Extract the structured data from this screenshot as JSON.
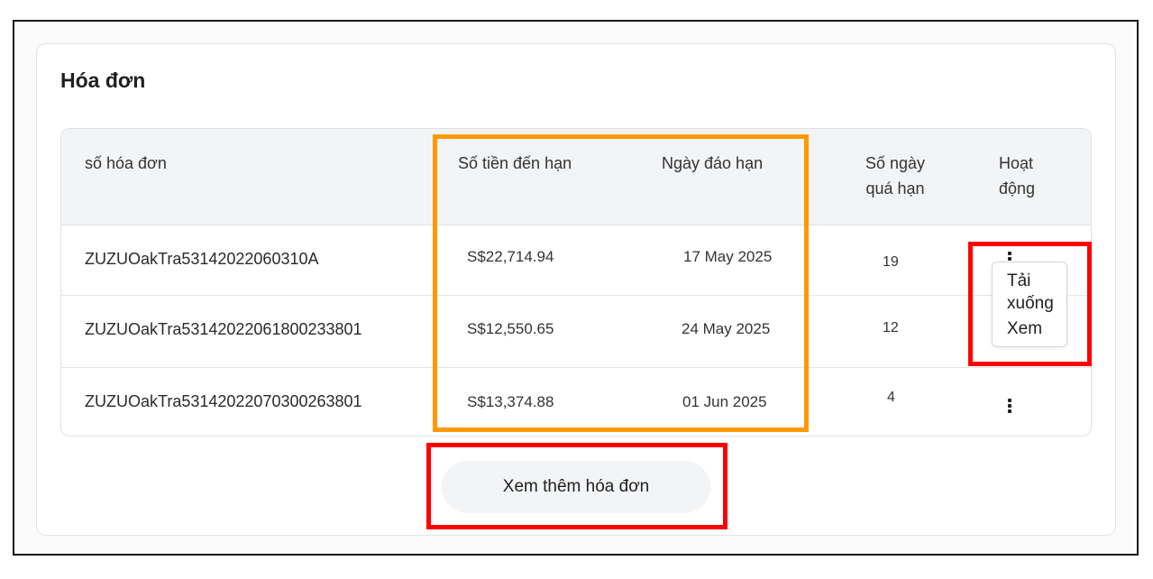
{
  "card": {
    "title": "Hóa đơn"
  },
  "table": {
    "headers": {
      "invoice_no": "số hóa đơn",
      "amount_due": "Số tiền đến hạn",
      "due_date": "Ngày đáo hạn",
      "days_overdue_line1": "Số ngày",
      "days_overdue_line2": "quá hạn",
      "actions_line1": "Hoạt",
      "actions_line2": "động"
    },
    "rows": [
      {
        "invoice_no": "ZUZUOakTra53142022060310A",
        "amount": "S$22,714.94",
        "date": "17 May 2025",
        "days": "19"
      },
      {
        "invoice_no": "ZUZUOakTra5314202206180023380​1",
        "amount": "S$12,550.65",
        "date": "24 May 2025",
        "days": "12"
      },
      {
        "invoice_no": "ZUZUOakTra53142022070300263801",
        "amount": "S$13,374.88",
        "date": "01 Jun 2025",
        "days": "4"
      }
    ]
  },
  "action_menu": {
    "download_line1": "Tải",
    "download_line2": "xuống",
    "view": "Xem"
  },
  "more_button": {
    "label": "Xem thêm hóa đơn"
  },
  "colors": {
    "highlight_orange": "#ff9900",
    "highlight_red": "#ff0000",
    "header_bg": "#f3f4f6"
  },
  "icons": {
    "row_menu": "kebab-vertical-icon"
  }
}
